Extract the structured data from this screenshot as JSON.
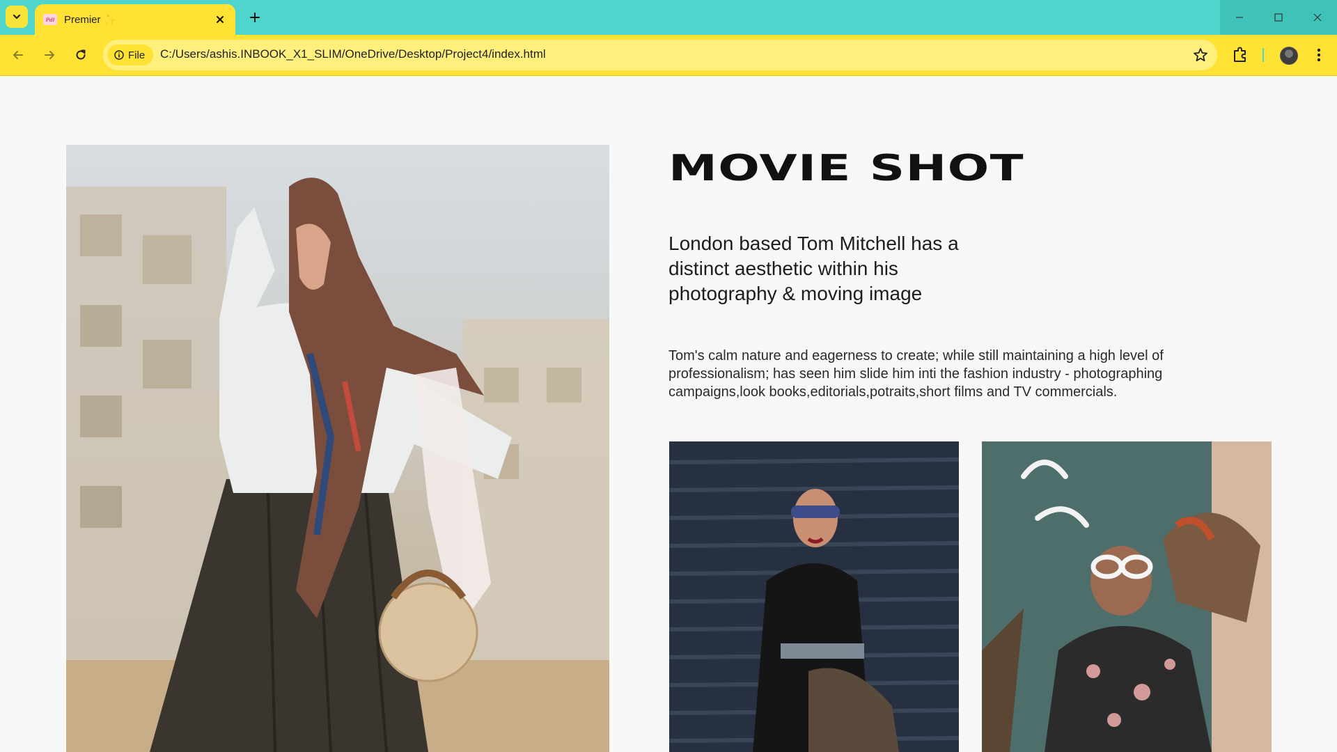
{
  "browser": {
    "tab_title": "Premier ✨",
    "tab_favicon_text": "Pdl",
    "address_chip": "File",
    "url": "C:/Users/ashis.INBOOK_X1_SLIM/OneDrive/Desktop/Project4/index.html",
    "colors": {
      "tabbar": "#4fd5cb",
      "toolbar": "#ffe234",
      "omnibox": "#fff07e"
    }
  },
  "page": {
    "title": "MOVIE SHOT",
    "lead": "London based Tom Mitchell has a distinct aesthetic within his photography & moving image",
    "body": "Tom's calm nature and eagerness to create; while still maintaining a high level of professionalism; has seen him slide him inti the fashion industry - photographing campaigns,look books,editorials,potraits,short films and TV commercials.",
    "images": {
      "hero": "woman-in-headscarf-photo",
      "thumb1": "woman-in-sunglasses-dark-shutter-photo",
      "thumb2": "woman-in-white-sunglasses-beverly-hills-photo"
    }
  }
}
